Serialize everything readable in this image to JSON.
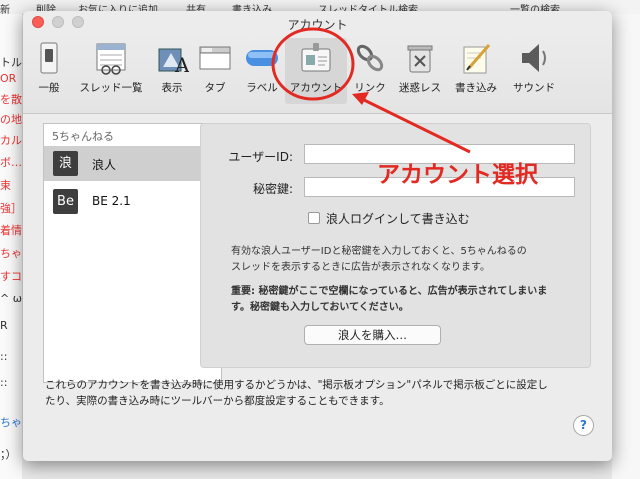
{
  "background": {
    "menubar": [
      "新",
      "削除",
      "お気に入りに追加",
      "共有",
      "書き込み…",
      "スレッドタイトル検索",
      "一覧の検索"
    ],
    "left_fragments": [
      "トル",
      "OR",
      "を散",
      "の地",
      "カル",
      "ボ…",
      "束",
      "強］",
      "着情",
      "ちゃん",
      "すコ",
      "^ ω",
      "R",
      "::",
      "::",
      "ちゃ",
      "；）"
    ]
  },
  "window": {
    "title": "アカウント"
  },
  "toolbar": {
    "items": [
      {
        "label": "一般",
        "icon": "general-switch-icon"
      },
      {
        "label": "スレッド一覧",
        "icon": "thread-list-icon"
      },
      {
        "label": "表示",
        "icon": "display-icon"
      },
      {
        "label": "タブ",
        "icon": "tab-icon"
      },
      {
        "label": "ラベル",
        "icon": "label-icon"
      },
      {
        "label": "アカウント",
        "icon": "account-id-card-icon"
      },
      {
        "label": "リンク",
        "icon": "link-icon"
      },
      {
        "label": "迷惑レス",
        "icon": "trash-icon"
      },
      {
        "label": "書き込み",
        "icon": "write-pen-icon"
      },
      {
        "label": "サウンド",
        "icon": "speaker-icon"
      }
    ]
  },
  "sidebar": {
    "header": "5ちゃんねる",
    "items": [
      {
        "badge": "浪",
        "label": "浪人"
      },
      {
        "badge": "Be",
        "label": "BE 2.1"
      }
    ]
  },
  "form": {
    "user_id_label": "ユーザーID:",
    "user_id_value": "",
    "secret_key_label": "秘密鍵:",
    "secret_key_value": "",
    "login_checkbox_label": "浪人ログインして書き込む",
    "login_checked": false,
    "info_line1": "有効な浪人ユーザーIDと秘密鍵を入力しておくと、5ちゃんねるの",
    "info_line2": "スレッドを表示するときに広告が表示されなくなります。",
    "warn_line1": "重要: 秘密鍵がここで空欄になっていると、広告が表示されてしまいま",
    "warn_line2": "す。秘密鍵も入力しておいてください。",
    "buy_button": "浪人を購入…"
  },
  "footer": {
    "line1": "これらのアカウントを書き込み時に使用するかどうかは、\"掲示板オプション\"パネルで掲示板ごとに設定し",
    "line2": "たり、実際の書き込み時にツールバーから都度設定することもできます。",
    "help": "?"
  },
  "annotation": {
    "text": "アカウント選択",
    "color": "#e32a22"
  }
}
